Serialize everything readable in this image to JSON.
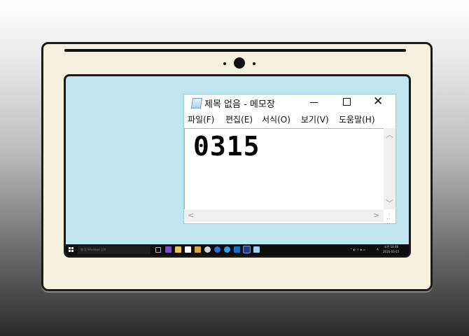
{
  "notepad": {
    "title": "제목 없음 - 메모장",
    "menu": [
      "파일(F)",
      "편집(E)",
      "서식(O)",
      "보기(V)",
      "도움말(H)"
    ],
    "document_text": "0315",
    "close_glyph": "✕"
  },
  "taskbar": {
    "search_placeholder": "웹 및 Windows 검색",
    "tray_ime": "A",
    "time": "오전 10:46",
    "date": "2016-03-15",
    "app_icons": [
      "task-view-icon",
      "visual-studio-icon",
      "file-explorer-icon",
      "store-icon",
      "app-icon",
      "app-icon",
      "edge-icon",
      "internet-explorer-icon",
      "outlook-icon",
      "powershell-icon",
      "notepad-icon"
    ]
  },
  "colors": {
    "desktop": "#bfe6ee",
    "bezel": "#f6f0de",
    "taskbar": "#0e0e0e"
  }
}
